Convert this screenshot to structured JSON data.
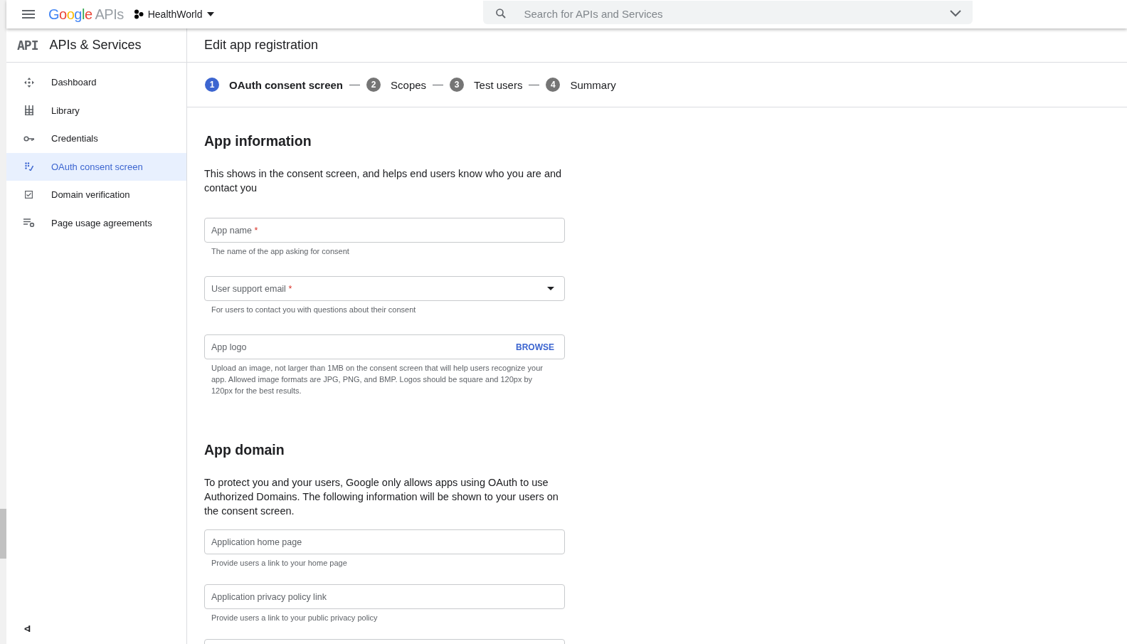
{
  "topbar": {
    "brand": "Google",
    "brand_suffix": "APIs",
    "project": "HealthWorld",
    "search": {
      "placeholder": "Search for APIs and Services"
    }
  },
  "sidebar": {
    "logo": "API",
    "title": "APIs & Services",
    "items": [
      {
        "label": "Dashboard",
        "selected": false
      },
      {
        "label": "Library",
        "selected": false
      },
      {
        "label": "Credentials",
        "selected": false
      },
      {
        "label": "OAuth consent screen",
        "selected": true
      },
      {
        "label": "Domain verification",
        "selected": false
      },
      {
        "label": "Page usage agreements",
        "selected": false
      }
    ],
    "collapse": "<I"
  },
  "page_title": "Edit app registration",
  "steps": [
    {
      "number": "1",
      "label": "OAuth consent screen",
      "selected": true
    },
    {
      "number": "2",
      "label": "Scopes",
      "selected": false
    },
    {
      "number": "3",
      "label": "Test users",
      "selected": false
    },
    {
      "number": "4",
      "label": "Summary",
      "selected": false
    }
  ],
  "sections": [
    {
      "title": "App information",
      "description": "This shows in the consent screen, and helps end users know who you are and contact you",
      "fields": [
        {
          "kind": "text",
          "placeholder": "App name",
          "required_mark": "*",
          "hint": "The name of the app asking for consent"
        },
        {
          "kind": "select",
          "placeholder": "User support email",
          "required_mark": "*",
          "hint": "For users to contact you with questions about their consent"
        },
        {
          "kind": "file",
          "placeholder": "App logo",
          "action": "BROWSE",
          "hint": "Upload an image, not larger than 1MB on the consent screen that will help users recognize your app. Allowed image formats are JPG, PNG, and BMP. Logos should be square and 120px by 120px for the best results."
        }
      ]
    },
    {
      "title": "App domain",
      "description": "To protect you and your users, Google only allows apps using OAuth to use Authorized Domains. The following information will be shown to your users on the consent screen.",
      "fields": [
        {
          "kind": "text",
          "placeholder": "Application home page",
          "hint": "Provide users a link to your home page"
        },
        {
          "kind": "text",
          "placeholder": "Application privacy policy link",
          "hint": "Provide users a link to your public privacy policy"
        },
        {
          "kind": "text"
        }
      ]
    }
  ]
}
